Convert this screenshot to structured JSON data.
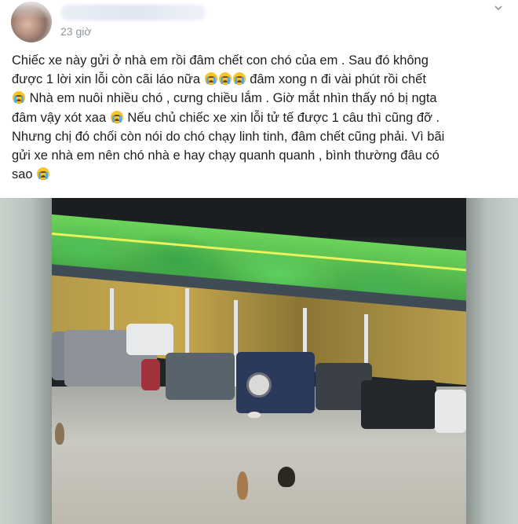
{
  "post": {
    "author_name": "",
    "timestamp": "23 giờ",
    "menu_icon": "chevron-down-icon",
    "text_lines": [
      "Chiếc xe này gửi ở nhà em rồi đâm chết con chó của em . Sau đó không",
      "được 1 lời xin lỗi còn cãi láo nữa",
      "đâm xong n đi vài phút rồi chết",
      "Nhà em nuôi nhiều chó , cưng chiều lắm . Giờ mắt nhìn thấy nó bị ngta",
      "đâm vậy xót xaa",
      "Nếu chủ chiếc xe xin lỗi tử tế được 1 câu thì cũng đỡ .",
      "Nhưng chị đó chối còn nói do chó chạy linh tinh, đâm chết cũng phải. Vì bãi",
      "gửi xe nhà em nên chó nhà e hay chạy quanh quanh , bình thường đâu có",
      "sao"
    ],
    "emoji_name": "loudly-crying-face-icon"
  },
  "video": {
    "description_icon": "video-thumbnail",
    "colors": {
      "trees": "#4fbf59",
      "shed": "#c7a94d",
      "ground": "#c9c8c1"
    }
  }
}
